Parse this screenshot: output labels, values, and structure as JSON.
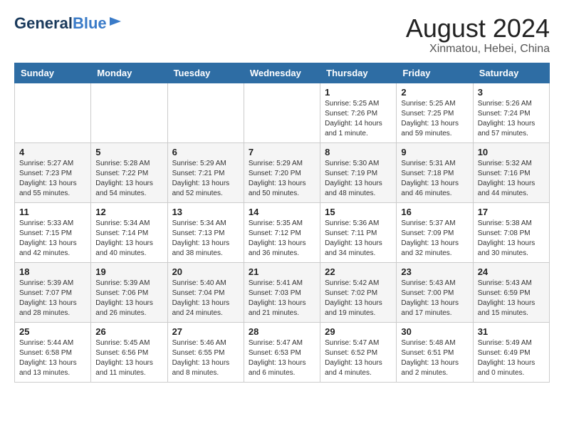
{
  "header": {
    "logo_general": "General",
    "logo_blue": "Blue",
    "month_year": "August 2024",
    "location": "Xinmatou, Hebei, China"
  },
  "weekdays": [
    "Sunday",
    "Monday",
    "Tuesday",
    "Wednesday",
    "Thursday",
    "Friday",
    "Saturday"
  ],
  "weeks": [
    [
      {
        "day": "",
        "info": ""
      },
      {
        "day": "",
        "info": ""
      },
      {
        "day": "",
        "info": ""
      },
      {
        "day": "",
        "info": ""
      },
      {
        "day": "1",
        "info": "Sunrise: 5:25 AM\nSunset: 7:26 PM\nDaylight: 14 hours\nand 1 minute."
      },
      {
        "day": "2",
        "info": "Sunrise: 5:25 AM\nSunset: 7:25 PM\nDaylight: 13 hours\nand 59 minutes."
      },
      {
        "day": "3",
        "info": "Sunrise: 5:26 AM\nSunset: 7:24 PM\nDaylight: 13 hours\nand 57 minutes."
      }
    ],
    [
      {
        "day": "4",
        "info": "Sunrise: 5:27 AM\nSunset: 7:23 PM\nDaylight: 13 hours\nand 55 minutes."
      },
      {
        "day": "5",
        "info": "Sunrise: 5:28 AM\nSunset: 7:22 PM\nDaylight: 13 hours\nand 54 minutes."
      },
      {
        "day": "6",
        "info": "Sunrise: 5:29 AM\nSunset: 7:21 PM\nDaylight: 13 hours\nand 52 minutes."
      },
      {
        "day": "7",
        "info": "Sunrise: 5:29 AM\nSunset: 7:20 PM\nDaylight: 13 hours\nand 50 minutes."
      },
      {
        "day": "8",
        "info": "Sunrise: 5:30 AM\nSunset: 7:19 PM\nDaylight: 13 hours\nand 48 minutes."
      },
      {
        "day": "9",
        "info": "Sunrise: 5:31 AM\nSunset: 7:18 PM\nDaylight: 13 hours\nand 46 minutes."
      },
      {
        "day": "10",
        "info": "Sunrise: 5:32 AM\nSunset: 7:16 PM\nDaylight: 13 hours\nand 44 minutes."
      }
    ],
    [
      {
        "day": "11",
        "info": "Sunrise: 5:33 AM\nSunset: 7:15 PM\nDaylight: 13 hours\nand 42 minutes."
      },
      {
        "day": "12",
        "info": "Sunrise: 5:34 AM\nSunset: 7:14 PM\nDaylight: 13 hours\nand 40 minutes."
      },
      {
        "day": "13",
        "info": "Sunrise: 5:34 AM\nSunset: 7:13 PM\nDaylight: 13 hours\nand 38 minutes."
      },
      {
        "day": "14",
        "info": "Sunrise: 5:35 AM\nSunset: 7:12 PM\nDaylight: 13 hours\nand 36 minutes."
      },
      {
        "day": "15",
        "info": "Sunrise: 5:36 AM\nSunset: 7:11 PM\nDaylight: 13 hours\nand 34 minutes."
      },
      {
        "day": "16",
        "info": "Sunrise: 5:37 AM\nSunset: 7:09 PM\nDaylight: 13 hours\nand 32 minutes."
      },
      {
        "day": "17",
        "info": "Sunrise: 5:38 AM\nSunset: 7:08 PM\nDaylight: 13 hours\nand 30 minutes."
      }
    ],
    [
      {
        "day": "18",
        "info": "Sunrise: 5:39 AM\nSunset: 7:07 PM\nDaylight: 13 hours\nand 28 minutes."
      },
      {
        "day": "19",
        "info": "Sunrise: 5:39 AM\nSunset: 7:06 PM\nDaylight: 13 hours\nand 26 minutes."
      },
      {
        "day": "20",
        "info": "Sunrise: 5:40 AM\nSunset: 7:04 PM\nDaylight: 13 hours\nand 24 minutes."
      },
      {
        "day": "21",
        "info": "Sunrise: 5:41 AM\nSunset: 7:03 PM\nDaylight: 13 hours\nand 21 minutes."
      },
      {
        "day": "22",
        "info": "Sunrise: 5:42 AM\nSunset: 7:02 PM\nDaylight: 13 hours\nand 19 minutes."
      },
      {
        "day": "23",
        "info": "Sunrise: 5:43 AM\nSunset: 7:00 PM\nDaylight: 13 hours\nand 17 minutes."
      },
      {
        "day": "24",
        "info": "Sunrise: 5:43 AM\nSunset: 6:59 PM\nDaylight: 13 hours\nand 15 minutes."
      }
    ],
    [
      {
        "day": "25",
        "info": "Sunrise: 5:44 AM\nSunset: 6:58 PM\nDaylight: 13 hours\nand 13 minutes."
      },
      {
        "day": "26",
        "info": "Sunrise: 5:45 AM\nSunset: 6:56 PM\nDaylight: 13 hours\nand 11 minutes."
      },
      {
        "day": "27",
        "info": "Sunrise: 5:46 AM\nSunset: 6:55 PM\nDaylight: 13 hours\nand 8 minutes."
      },
      {
        "day": "28",
        "info": "Sunrise: 5:47 AM\nSunset: 6:53 PM\nDaylight: 13 hours\nand 6 minutes."
      },
      {
        "day": "29",
        "info": "Sunrise: 5:47 AM\nSunset: 6:52 PM\nDaylight: 13 hours\nand 4 minutes."
      },
      {
        "day": "30",
        "info": "Sunrise: 5:48 AM\nSunset: 6:51 PM\nDaylight: 13 hours\nand 2 minutes."
      },
      {
        "day": "31",
        "info": "Sunrise: 5:49 AM\nSunset: 6:49 PM\nDaylight: 13 hours\nand 0 minutes."
      }
    ]
  ]
}
